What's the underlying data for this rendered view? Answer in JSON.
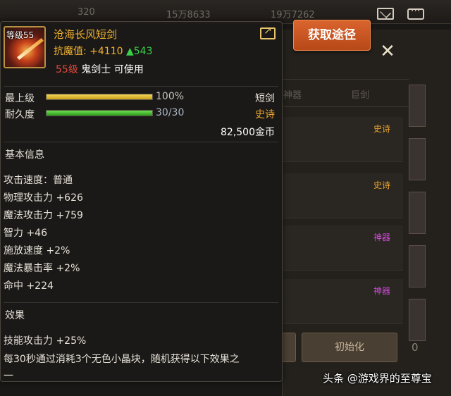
{
  "background": {
    "top_stats": [
      "320",
      "15万8633",
      "19万7262"
    ],
    "tabs": [
      "神器",
      "巨剑"
    ],
    "rows": [
      {
        "tag": "史诗",
        "color": "#e8a42e"
      },
      {
        "tag": "史诗",
        "color": "#e8a42e"
      },
      {
        "tag": "神器",
        "color": "#d04ad8"
      },
      {
        "tag": "神器",
        "color": "#d04ad8"
      }
    ],
    "buttons": [
      "初始化"
    ],
    "bottom_partial": "0"
  },
  "get_button": {
    "label": "获取途径"
  },
  "close": {
    "glyph": "✕"
  },
  "item": {
    "level_tag": "等级55",
    "name": "沧海长风短剑",
    "resist_label": "抗魔值:",
    "resist_value": "+4110",
    "resist_up": "▲543",
    "req_level": "55级",
    "req_text": "鬼剑士 可使用",
    "type": "短剑",
    "grade": "史诗",
    "price": "82,500金币"
  },
  "bars": {
    "upgrade": {
      "label": "最上级",
      "value_text": "100%",
      "fraction": 1.0
    },
    "durability": {
      "label": "耐久度",
      "value_text": "30/30",
      "fraction": 1.0
    }
  },
  "basic_info": {
    "title": "基本信息",
    "stats": [
      "攻击速度：普通",
      "物理攻击力 +626",
      "魔法攻击力 +759",
      "智力 +46",
      "施放速度 +2%",
      "魔法暴击率 +2%",
      "命中 +224"
    ]
  },
  "effects": {
    "title": "效果",
    "lines": [
      "技能攻击力 +25%",
      "每30秒通过消耗3个无色小晶块，随机获得以下效果之",
      "一"
    ]
  },
  "watermark": "头条 @游戏界的至尊宝"
}
